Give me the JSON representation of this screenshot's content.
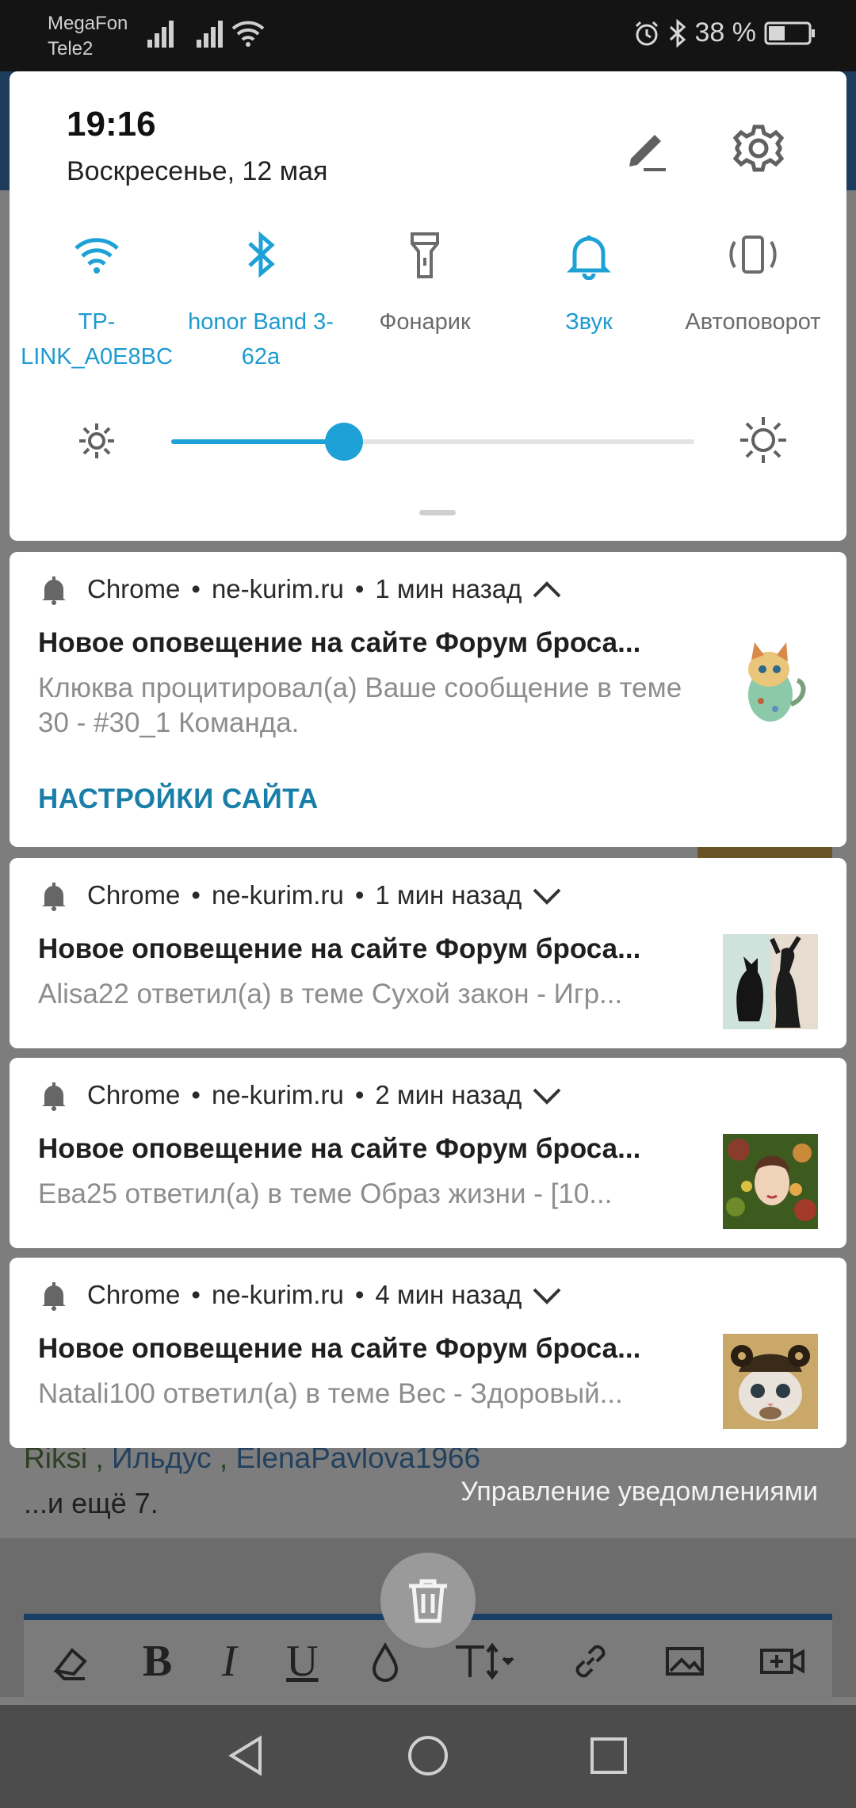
{
  "status_bar": {
    "carrier1": "MegaFon",
    "carrier2": "Tele2",
    "battery": "38 %"
  },
  "quick_settings": {
    "time": "19:16",
    "date": "Воскресенье, 12 мая",
    "tiles": [
      {
        "label": "TP-LINK_A0E8BC",
        "icon": "wifi-icon",
        "active": true
      },
      {
        "label": "honor Band 3-62a",
        "icon": "bluetooth-icon",
        "active": true
      },
      {
        "label": "Фонарик",
        "icon": "flashlight-icon",
        "active": false
      },
      {
        "label": "Звук",
        "icon": "bell-icon",
        "active": true
      },
      {
        "label": "Автоповорот",
        "icon": "autorotate-icon",
        "active": false
      }
    ],
    "brightness_level": 0.33,
    "accent_color": "#1ea1d6"
  },
  "notifications": [
    {
      "app": "Chrome",
      "site": "ne-kurim.ru",
      "time": "1 мин назад",
      "title": "Новое оповещение на сайте Форум броса...",
      "text": "Клюква процитировал(а) Ваше сообщение в теме 30 - #30_1 Команда.",
      "action": "НАСТРОЙКИ САЙТА",
      "expanded": true,
      "thumb": "cat-illustration"
    },
    {
      "app": "Chrome",
      "site": "ne-kurim.ru",
      "time": "1 мин назад",
      "title": "Новое оповещение на сайте Форум броса...",
      "text": "Alisa22 ответил(а) в теме Сухой закон - Игр...",
      "thumb": "black-cats"
    },
    {
      "app": "Chrome",
      "site": "ne-kurim.ru",
      "time": "2 мин назад",
      "title": "Новое оповещение на сайте Форум броса...",
      "text": "Ева25 ответил(а) в теме Образ жизни - [10...",
      "thumb": "floral-woman"
    },
    {
      "app": "Chrome",
      "site": "ne-kurim.ru",
      "time": "4 мин назад",
      "title": "Новое оповещение на сайте Форум броса...",
      "text": "Natali100 ответил(а) в теме Вес - Здоровый...",
      "thumb": "kitten-hat"
    }
  ],
  "background": {
    "mention_names": [
      "Riksi",
      "Ильдус",
      "ElenaPavlova1966"
    ],
    "separator": " , ",
    "more": "...и ещё 7."
  },
  "manage_notifications": "Управление уведомлениями"
}
